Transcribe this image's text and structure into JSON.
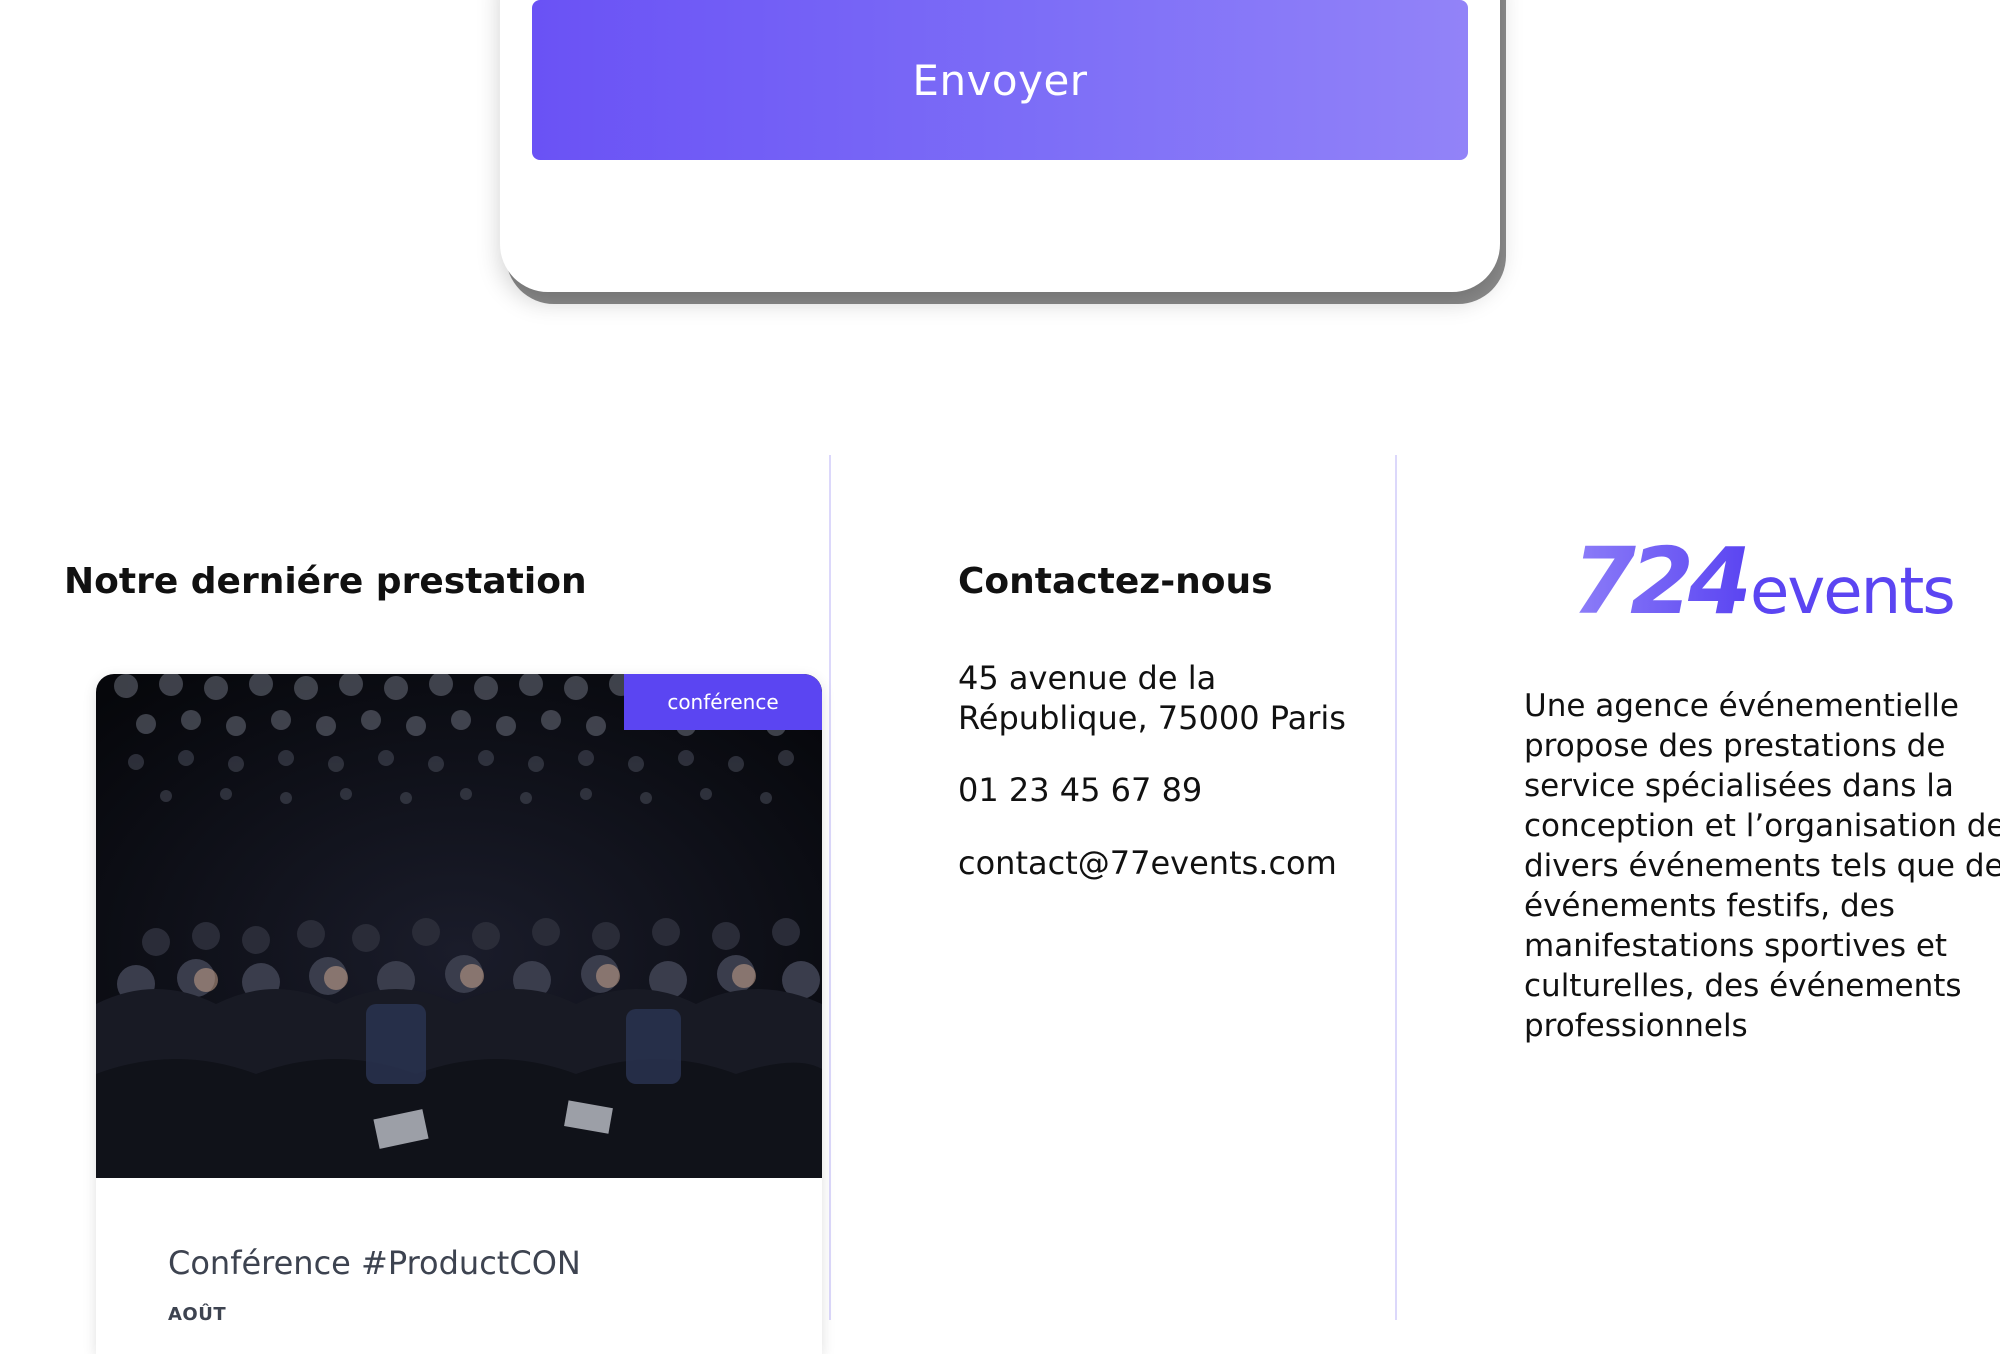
{
  "form": {
    "submit_label": "Envoyer"
  },
  "prestation": {
    "title": "Notre derniére prestation",
    "tag": "conférence",
    "name": "Conférence #ProductCON",
    "month": "AOÛT",
    "photo_description": "conference-audience-photo"
  },
  "contact": {
    "title": "Contactez-nous",
    "address_line1": "45 avenue de la",
    "address_line2": "République, 75000 Paris",
    "phone": "01 23 45 67 89",
    "email": "contact@77events.com"
  },
  "about": {
    "logo_digits": "724",
    "logo_word": "events",
    "description": "Une agence événementielle propose des prestations de service spécialisées dans la conception et l’organisation de divers événements tels que des événements festifs, des manifestations sportives et culturelles, des événements professionnels"
  },
  "colors": {
    "accent": "#5b45f2",
    "button_gradient_start": "#6a52f5",
    "button_gradient_end": "#9283f8",
    "divider": "#dcd8fb"
  }
}
